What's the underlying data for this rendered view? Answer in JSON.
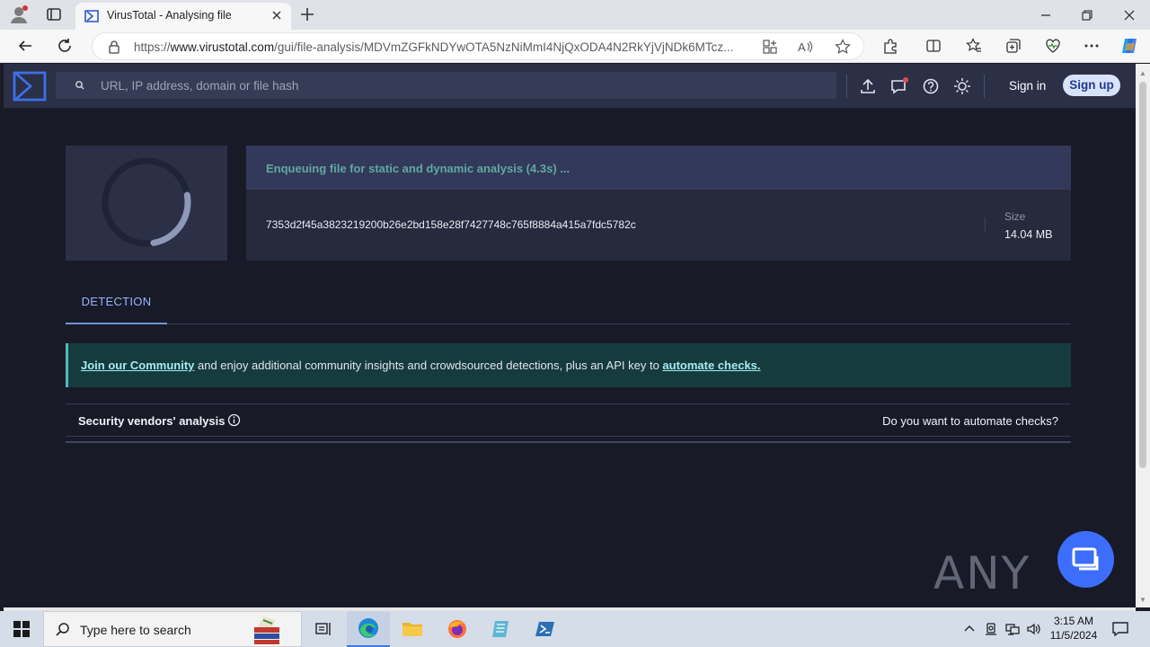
{
  "browser": {
    "tab_title": "VirusTotal - Analysing file",
    "url_prefix": "https://",
    "url_domain": "www.virustotal.com",
    "url_path": "/gui/file-analysis/MDVmZGFkNDYwOTA5NzNiMmI4NjQxODA4N2RkYjVjNDk6MTcz..."
  },
  "vt": {
    "search_placeholder": "URL, IP address, domain or file hash",
    "signin_label": "Sign in",
    "signup_label": "Sign up"
  },
  "analysis": {
    "status": "Enqueuing file for static and dynamic analysis (4.3s) ...",
    "hash": "7353d2f45a3823219200b26e2bd158e28f7427748c765f8884a415a7fdc5782c",
    "size_label": "Size",
    "size_value": "14.04 MB",
    "progress_fraction": 0.25
  },
  "tabs": {
    "detection_label": "DETECTION"
  },
  "banner": {
    "link1": "Join our Community",
    "middle": " and enjoy additional community insights and crowdsourced detections, plus an API key to ",
    "link2": "automate checks."
  },
  "vendors": {
    "title": "Security vendors' analysis",
    "automate_text": "Do you want to automate checks?"
  },
  "watermark": "ANY RUN",
  "taskbar": {
    "search_placeholder": "Type here to search",
    "time": "3:15 AM",
    "date": "11/5/2024"
  },
  "colors": {
    "page_bg": "#191a27",
    "nav_bg": "#2b3047",
    "accent_blue": "#6f94d8",
    "status_teal": "#5fa99f",
    "banner_bg": "#163b3e"
  }
}
